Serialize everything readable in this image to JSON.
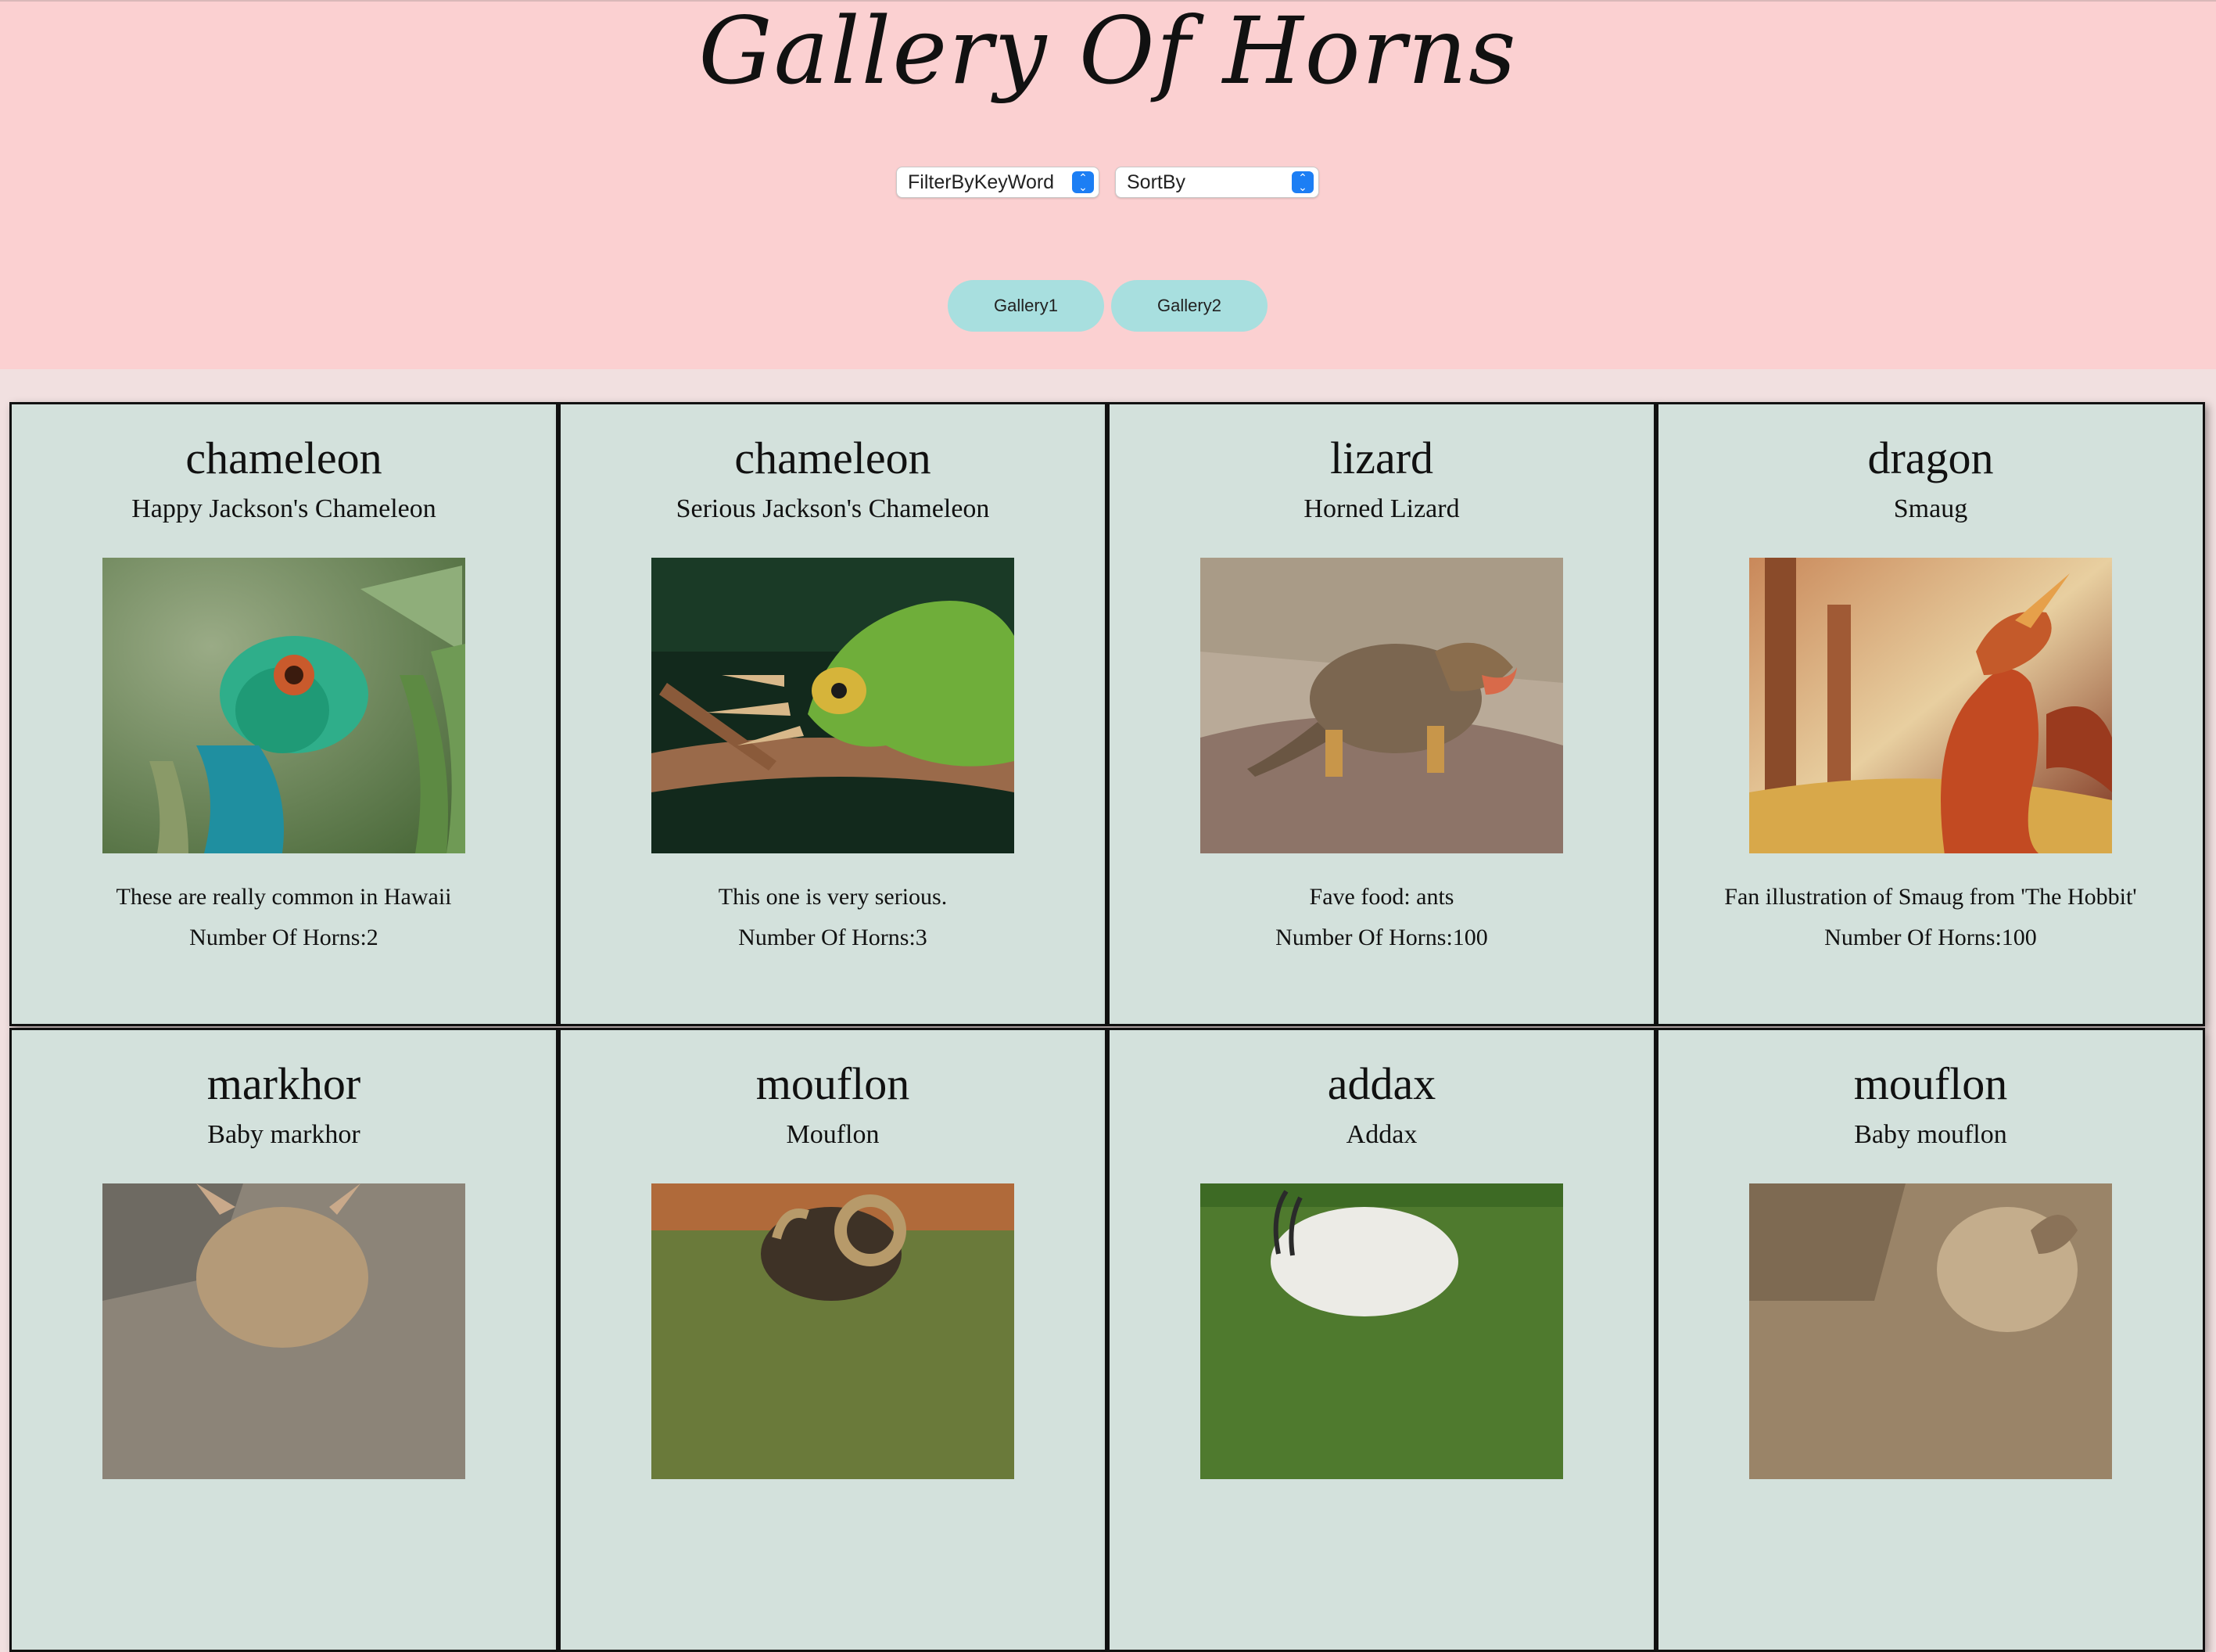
{
  "header": {
    "title": "Gallery Of Horns",
    "filter_select": {
      "selected": "FilterByKeyWord"
    },
    "sort_select": {
      "selected": "SortBy"
    },
    "gallery_buttons": [
      "Gallery1",
      "Gallery2"
    ]
  },
  "colors": {
    "header_bg": "#fbd0d1",
    "page_bg": "#f1e0e0",
    "card_bg": "#d3e1dc",
    "button_bg": "#a8dfdf",
    "select_accent": "#1c7ef4"
  },
  "cards": [
    {
      "keyword": "chameleon",
      "title": "Happy Jackson's Chameleon",
      "description": "These are really common in Hawaii",
      "horns_text": "Number Of Horns:2",
      "image": "green chameleon among leaves"
    },
    {
      "keyword": "chameleon",
      "title": "Serious Jackson's Chameleon",
      "description": "This one is very serious.",
      "horns_text": "Number Of Horns:3",
      "image": "three-horned chameleon on branch"
    },
    {
      "keyword": "lizard",
      "title": "Horned Lizard",
      "description": "Fave food: ants",
      "horns_text": "Number Of Horns:100",
      "image": "horned lizard on rock"
    },
    {
      "keyword": "dragon",
      "title": "Smaug",
      "description": "Fan illustration of Smaug from 'The Hobbit'",
      "horns_text": "Number Of Horns:100",
      "image": "red dragon illustration"
    },
    {
      "keyword": "markhor",
      "title": "Baby markhor",
      "description": "",
      "horns_text": "",
      "image": "baby markhor"
    },
    {
      "keyword": "mouflon",
      "title": "Mouflon",
      "description": "",
      "horns_text": "",
      "image": "mouflon ram"
    },
    {
      "keyword": "addax",
      "title": "Addax",
      "description": "",
      "horns_text": "",
      "image": "white addax on grass"
    },
    {
      "keyword": "mouflon",
      "title": "Baby mouflon",
      "description": "",
      "horns_text": "",
      "image": "baby mouflon"
    }
  ]
}
